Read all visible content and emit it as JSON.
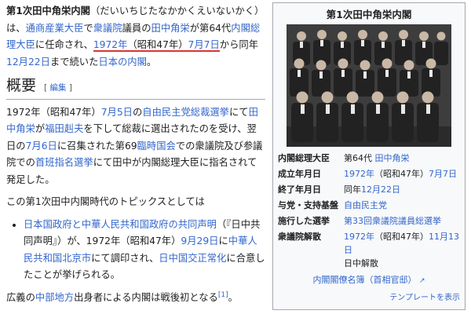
{
  "intro": {
    "title": "第1次田中角栄内閣",
    "reading": "（だいいちじたなかかくえいないかく）は、",
    "l1": "通商産業大臣",
    "t1": "で",
    "l2": "衆議院",
    "t2": "議員の",
    "l3": "田中角栄",
    "t3": "が第64代",
    "l4": "内閣総理大臣",
    "t4": "に任命され、",
    "l5": "1972年",
    "t5": "（昭和47年）",
    "l6": "7月7日",
    "t6": "から同年",
    "l7": "12月22日",
    "t7": "まで続いた",
    "l8": "日本の内閣",
    "t8": "。"
  },
  "section": {
    "title": "概要",
    "edit_open": "[",
    "edit_label": "編集",
    "edit_close": "]"
  },
  "para1": {
    "t1": "1972年（昭和47年）",
    "l1": "7月5日",
    "t2": "の",
    "l2": "自由民主党総裁選挙",
    "t3": "にて",
    "l3": "田中角栄",
    "t4": "が",
    "l4": "福田赳夫",
    "t5": "を下して総裁に選出されたのを受け、翌日の",
    "l5": "7月6日",
    "t6": "に召集された第69",
    "l6": "臨時国会",
    "t7": "での衆議院及び参議院での",
    "l7": "首班指名選挙",
    "t8": "にて田中が内閣総理大臣に指名されて発足した。"
  },
  "para2": {
    "text": "この第1次田中内閣時代のトピックスとしては"
  },
  "bullet": {
    "l1": "日本国政府と中華人民共和国政府の共同声明",
    "t1": "（『日中共同声明』）が、1972年（昭和47年）",
    "l2": "9月29日",
    "t2": "に",
    "l3": "中華人民共和国北京市",
    "t3": "にて調印され、",
    "l4": "日中国交正常化",
    "t4": "に合意したことが挙げられる。"
  },
  "para3": {
    "t1": "広義の",
    "l1": "中部地方",
    "t2": "出身者による内閣は戦後初となる",
    "ref": "[1]",
    "t3": "。"
  },
  "infobox": {
    "title": "第1次田中角栄内閣",
    "rows": [
      {
        "label": "内閣総理大臣",
        "pre": "第64代 ",
        "link": "田中角栄",
        "post": ""
      },
      {
        "label": "成立年月日",
        "pre": "",
        "link": "1972年",
        "post": "（昭和47年）",
        "link2": "7月7日"
      },
      {
        "label": "終了年月日",
        "pre": "同年",
        "link": "12月22日",
        "post": ""
      },
      {
        "label": "与党・支持基盤",
        "pre": "",
        "link": "自由民主党",
        "post": ""
      },
      {
        "label": "施行した選挙",
        "pre": "",
        "link": "第33回衆議院議員総選挙",
        "post": ""
      },
      {
        "label": "衆議院解散",
        "pre": "",
        "link": "1972年",
        "post": "（昭和47年）",
        "link2": "11月13日",
        "post2": "日中解散"
      }
    ],
    "footer_link": "内閣閣僚名簿（首相官邸）",
    "template_link": "テンプレートを表示"
  },
  "colors": {
    "link": "#3366cc",
    "underline": "#dd3333",
    "infobox_bg": "#f8f9fa",
    "border": "#a2a9b1"
  }
}
